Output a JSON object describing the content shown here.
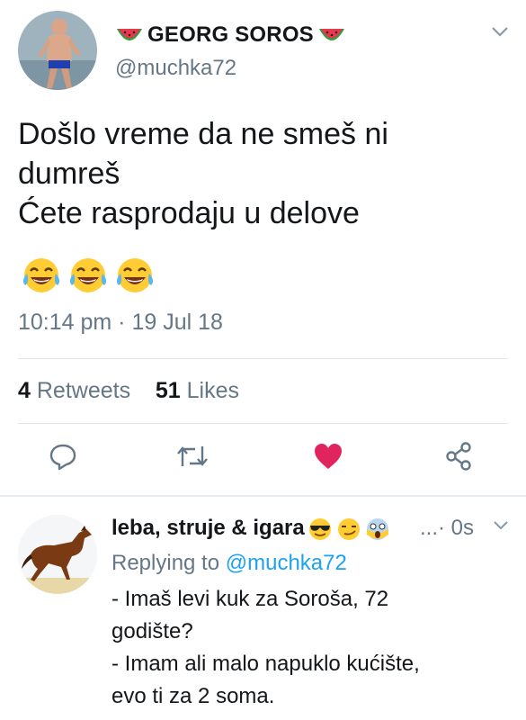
{
  "tweet": {
    "display_name": "GEORG SOROS",
    "name_emoji": "watermelon-icon",
    "handle": "@muchka72",
    "text_lines": [
      "Došlo vreme da ne smeš ni",
      "dumreš",
      "Ćete rasprodaju u delove"
    ],
    "emoji": [
      "crying-laughing-face-icon",
      "crying-laughing-face-icon",
      "crying-laughing-face-icon"
    ],
    "timestamp": "10:14 pm · 19 Jul 18",
    "retweets_count": "4",
    "retweets_label": "Retweets",
    "likes_count": "51",
    "likes_label": "Likes",
    "actions": [
      "reply-icon",
      "retweet-icon",
      "like-icon",
      "share-icon"
    ],
    "like_color": "#e0245e"
  },
  "reply": {
    "display_name": "leba, struje & igara",
    "name_emoji": [
      "sunglasses-face-icon",
      "smirking-face-icon",
      "screaming-face-icon"
    ],
    "ellipsis": "...",
    "time": "· 0s",
    "replying_prefix": "Replying to",
    "replying_to": "@muchka72",
    "text_lines": [
      "- Imaš levi kuk za Soroša, 72",
      "godište?",
      "- Imam ali malo napuklo kućište,",
      "evo ti za 2 soma."
    ],
    "mention_color": "#1da1f2"
  }
}
